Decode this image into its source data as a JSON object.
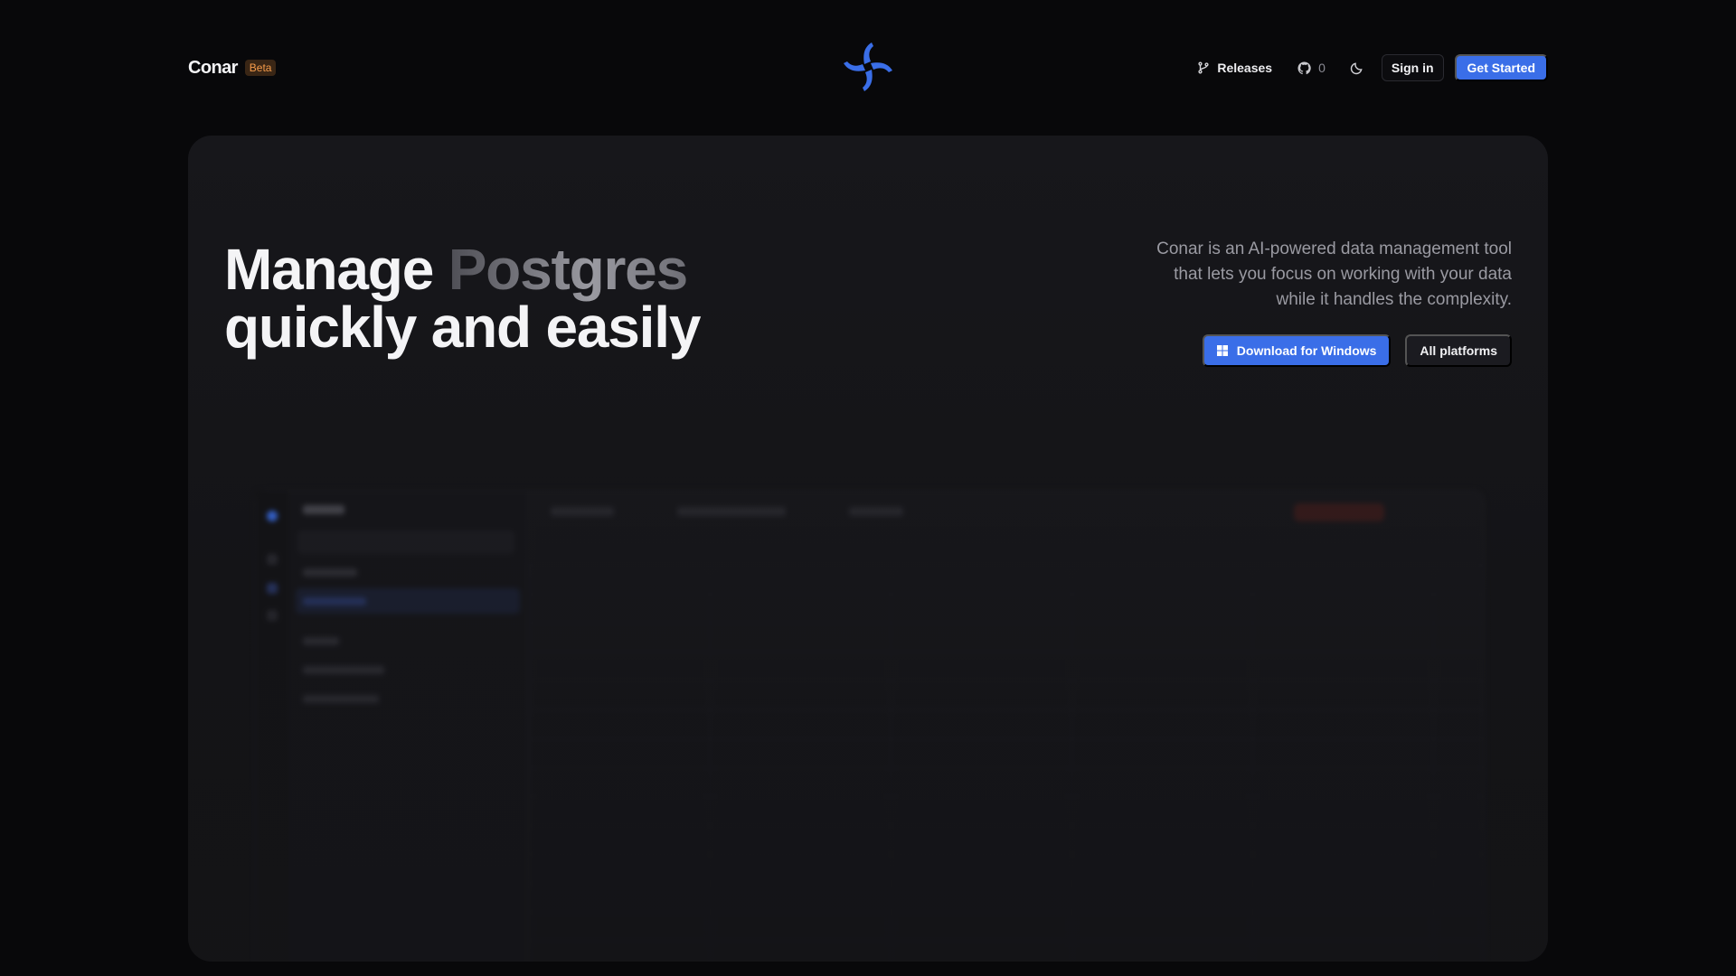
{
  "nav": {
    "brand": "Conar",
    "badge": "Beta",
    "releases_label": "Releases",
    "github_stars": "0",
    "signin_label": "Sign in",
    "get_started_label": "Get Started"
  },
  "hero": {
    "headline_prefix": "Manage",
    "headline_word": "Postgres",
    "headline_line2": "quickly and easily",
    "tagline": "Conar is an AI-powered data management tool that lets you focus on working with your data while it handles the complexity.",
    "download_label": "Download for Windows",
    "platforms_label": "All platforms"
  },
  "colors": {
    "accent": "#3a6ee8",
    "background": "#08080a",
    "card": "#161619",
    "badge_text": "#f59b4a"
  },
  "icons": {
    "logo": "pinwheel-logo-icon",
    "releases": "git-branch-icon",
    "github": "github-icon",
    "theme": "moon-icon",
    "download": "windows-icon"
  }
}
